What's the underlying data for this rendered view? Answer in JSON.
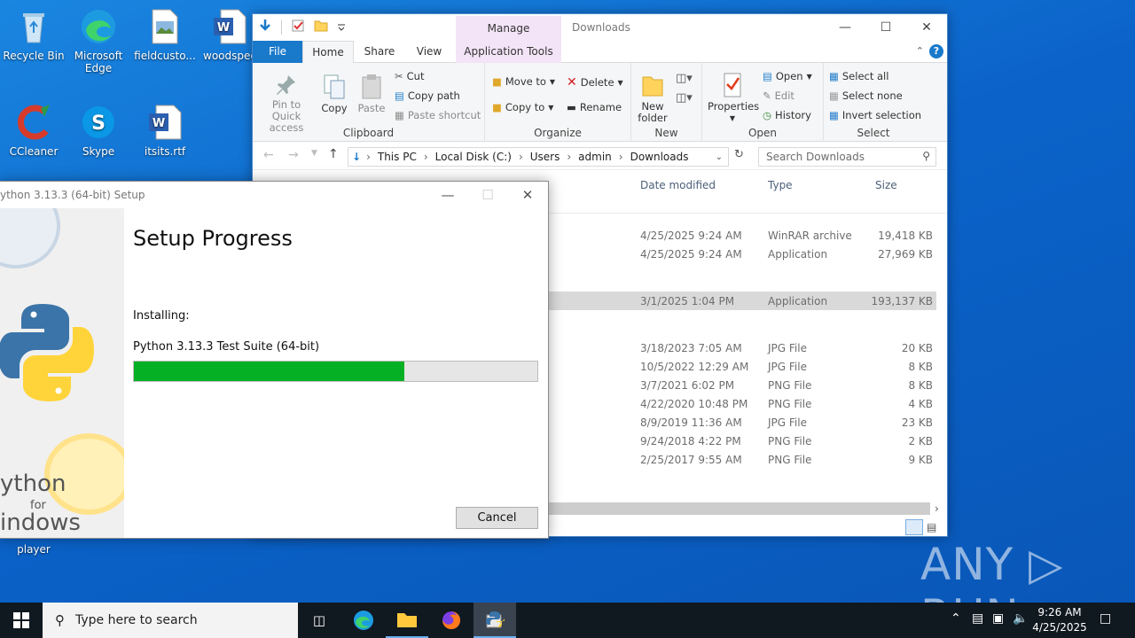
{
  "desktop": {
    "icons": [
      {
        "label": "Recycle Bin"
      },
      {
        "label": "Microsoft Edge"
      },
      {
        "label": "fieldcusto..."
      },
      {
        "label": "woodspec"
      },
      {
        "label": "CCleaner"
      },
      {
        "label": "Skype"
      },
      {
        "label": "itsits.rtf"
      },
      {
        "label": "player"
      }
    ],
    "watermark": "ANY ▷ RUN"
  },
  "explorer": {
    "title": "Downloads",
    "manage_label": "Manage",
    "tabs": {
      "file": "File",
      "home": "Home",
      "share": "Share",
      "view": "View",
      "app_tools": "Application Tools"
    },
    "ribbon": {
      "pin": "Pin to Quick access",
      "copy": "Copy",
      "paste": "Paste",
      "cut": "Cut",
      "copy_path": "Copy path",
      "paste_shortcut": "Paste shortcut",
      "clipboard": "Clipboard",
      "move_to": "Move to",
      "copy_to": "Copy to",
      "delete": "Delete",
      "rename": "Rename",
      "organize": "Organize",
      "new_folder": "New folder",
      "new": "New",
      "properties": "Properties",
      "open": "Open",
      "edit": "Edit",
      "history": "History",
      "open_group": "Open",
      "select_all": "Select all",
      "select_none": "Select none",
      "invert_selection": "Invert selection",
      "select_group": "Select"
    },
    "breadcrumb": [
      "This PC",
      "Local Disk (C:)",
      "Users",
      "admin",
      "Downloads"
    ],
    "search_placeholder": "Search Downloads",
    "columns": {
      "date": "Date modified",
      "type": "Type",
      "size": "Size"
    },
    "rows": [
      {
        "date": "4/25/2025 9:24 AM",
        "type": "WinRAR archive",
        "size": "19,418 KB"
      },
      {
        "date": "4/25/2025 9:24 AM",
        "type": "Application",
        "size": "27,969 KB"
      },
      {
        "date": "3/1/2025 1:04 PM",
        "type": "Application",
        "size": "193,137 KB"
      },
      {
        "date": "3/18/2023 7:05 AM",
        "type": "JPG File",
        "size": "20 KB"
      },
      {
        "date": "10/5/2022 12:29 AM",
        "type": "JPG File",
        "size": "8 KB"
      },
      {
        "date": "3/7/2021 6:02 PM",
        "type": "PNG File",
        "size": "8 KB"
      },
      {
        "date": "4/22/2020 10:48 PM",
        "type": "PNG File",
        "size": "4 KB"
      },
      {
        "date": "8/9/2019 11:36 AM",
        "type": "JPG File",
        "size": "23 KB"
      },
      {
        "date": "9/24/2018 4:22 PM",
        "type": "PNG File",
        "size": "2 KB"
      },
      {
        "date": "2/25/2017 9:55 AM",
        "type": "PNG File",
        "size": "9 KB"
      }
    ]
  },
  "setup": {
    "title": "ython 3.13.3 (64-bit) Setup",
    "heading": "Setup Progress",
    "installing_label": "Installing:",
    "package": "Python 3.13.3 Test Suite (64-bit)",
    "progress_fraction": 0.67,
    "cancel": "Cancel",
    "logo_text_1": "ython",
    "logo_text_2": "for",
    "logo_text_3": "indows"
  },
  "taskbar": {
    "search_placeholder": "Type here to search",
    "time": "9:26 AM",
    "date": "4/25/2025"
  },
  "colors": {
    "accent": "#1979ca",
    "progress": "#06b025",
    "manage": "#f3e4f7"
  }
}
